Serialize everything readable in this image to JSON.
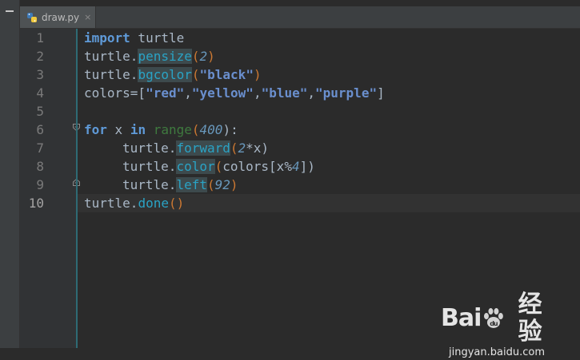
{
  "tab": {
    "filename": "draw.py",
    "close_glyph": "×",
    "icon": "python-file-icon"
  },
  "toolstrip": {
    "collapse_icon": "minus-icon"
  },
  "gutter": {
    "line_numbers": [
      "1",
      "2",
      "3",
      "4",
      "5",
      "6",
      "7",
      "8",
      "9",
      "10"
    ]
  },
  "code": {
    "l1": {
      "kw": "import",
      "rest": " turtle"
    },
    "l2": {
      "obj": "turtle.",
      "fn": "pensize",
      "open": "(",
      "num": "2",
      "close": ")"
    },
    "l3": {
      "obj": "turtle.",
      "fn": "bgcolor",
      "open": "(",
      "str": "\"black\"",
      "close": ")"
    },
    "l4": {
      "pre": "colors=[",
      "s1": "\"red\"",
      "c1": ",",
      "s2": "\"yellow\"",
      "c2": ",",
      "s3": "\"blue\"",
      "c3": ",",
      "s4": "\"purple\"",
      "post": "]"
    },
    "l6": {
      "kw1": "for",
      "var": " x ",
      "kw2": "in",
      "sp": " ",
      "bi": "range",
      "open": "(",
      "num": "400",
      "close": "):"
    },
    "l7": {
      "obj": "turtle.",
      "fn": "forward",
      "open": "(",
      "num": "2",
      "rest": "*x)"
    },
    "l8": {
      "obj": "turtle.",
      "fn": "color",
      "open": "(",
      "a": "colors[x%",
      "num": "4",
      "rest": "])"
    },
    "l9": {
      "obj": "turtle.",
      "fn": "left",
      "open": "(",
      "num": "92",
      "close": ")"
    },
    "l10": {
      "obj": "turtle.",
      "fn": "done",
      "parens": "()"
    }
  },
  "watermark": {
    "logo_left": "Bai",
    "logo_right": "经验",
    "url": "jingyan.baidu.com"
  },
  "colors": {
    "background": "#2b2b2b",
    "gutter": "#313335",
    "keyword": "#cc7832",
    "keyword_blue": "#5f9ad8",
    "function": "#2aa3c5",
    "string": "#6a8fce",
    "number": "#6897bb",
    "builtin": "#3f7a3f",
    "text": "#a9b7c6"
  }
}
